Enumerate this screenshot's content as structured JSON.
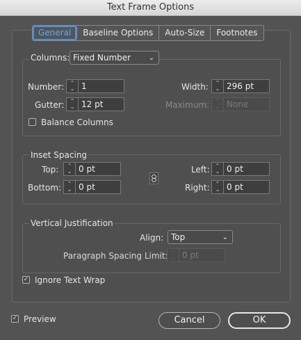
{
  "window": {
    "title": "Text Frame Options"
  },
  "tabs": [
    {
      "label": "General"
    },
    {
      "label": "Baseline Options"
    },
    {
      "label": "Auto-Size"
    },
    {
      "label": "Footnotes"
    }
  ],
  "columns": {
    "label": "Columns:",
    "mode": "Fixed Number",
    "number_label": "Number:",
    "number_value": "1",
    "gutter_label": "Gutter:",
    "gutter_value": "12 pt",
    "width_label": "Width:",
    "width_value": "296 pt",
    "maximum_label": "Maximum:",
    "maximum_value": "None",
    "balance_label": "Balance Columns",
    "balance_checked": false
  },
  "inset": {
    "title": "Inset Spacing",
    "top_label": "Top:",
    "top_value": "0 pt",
    "bottom_label": "Bottom:",
    "bottom_value": "0 pt",
    "left_label": "Left:",
    "left_value": "0 pt",
    "right_label": "Right:",
    "right_value": "0 pt"
  },
  "vertical": {
    "title": "Vertical Justification",
    "align_label": "Align:",
    "align_value": "Top",
    "psl_label": "Paragraph Spacing Limit:",
    "psl_value": "0 pt"
  },
  "ignore_wrap": {
    "label": "Ignore Text Wrap",
    "checked": true
  },
  "preview": {
    "label": "Preview",
    "checked": true
  },
  "buttons": {
    "cancel": "Cancel",
    "ok": "OK"
  }
}
